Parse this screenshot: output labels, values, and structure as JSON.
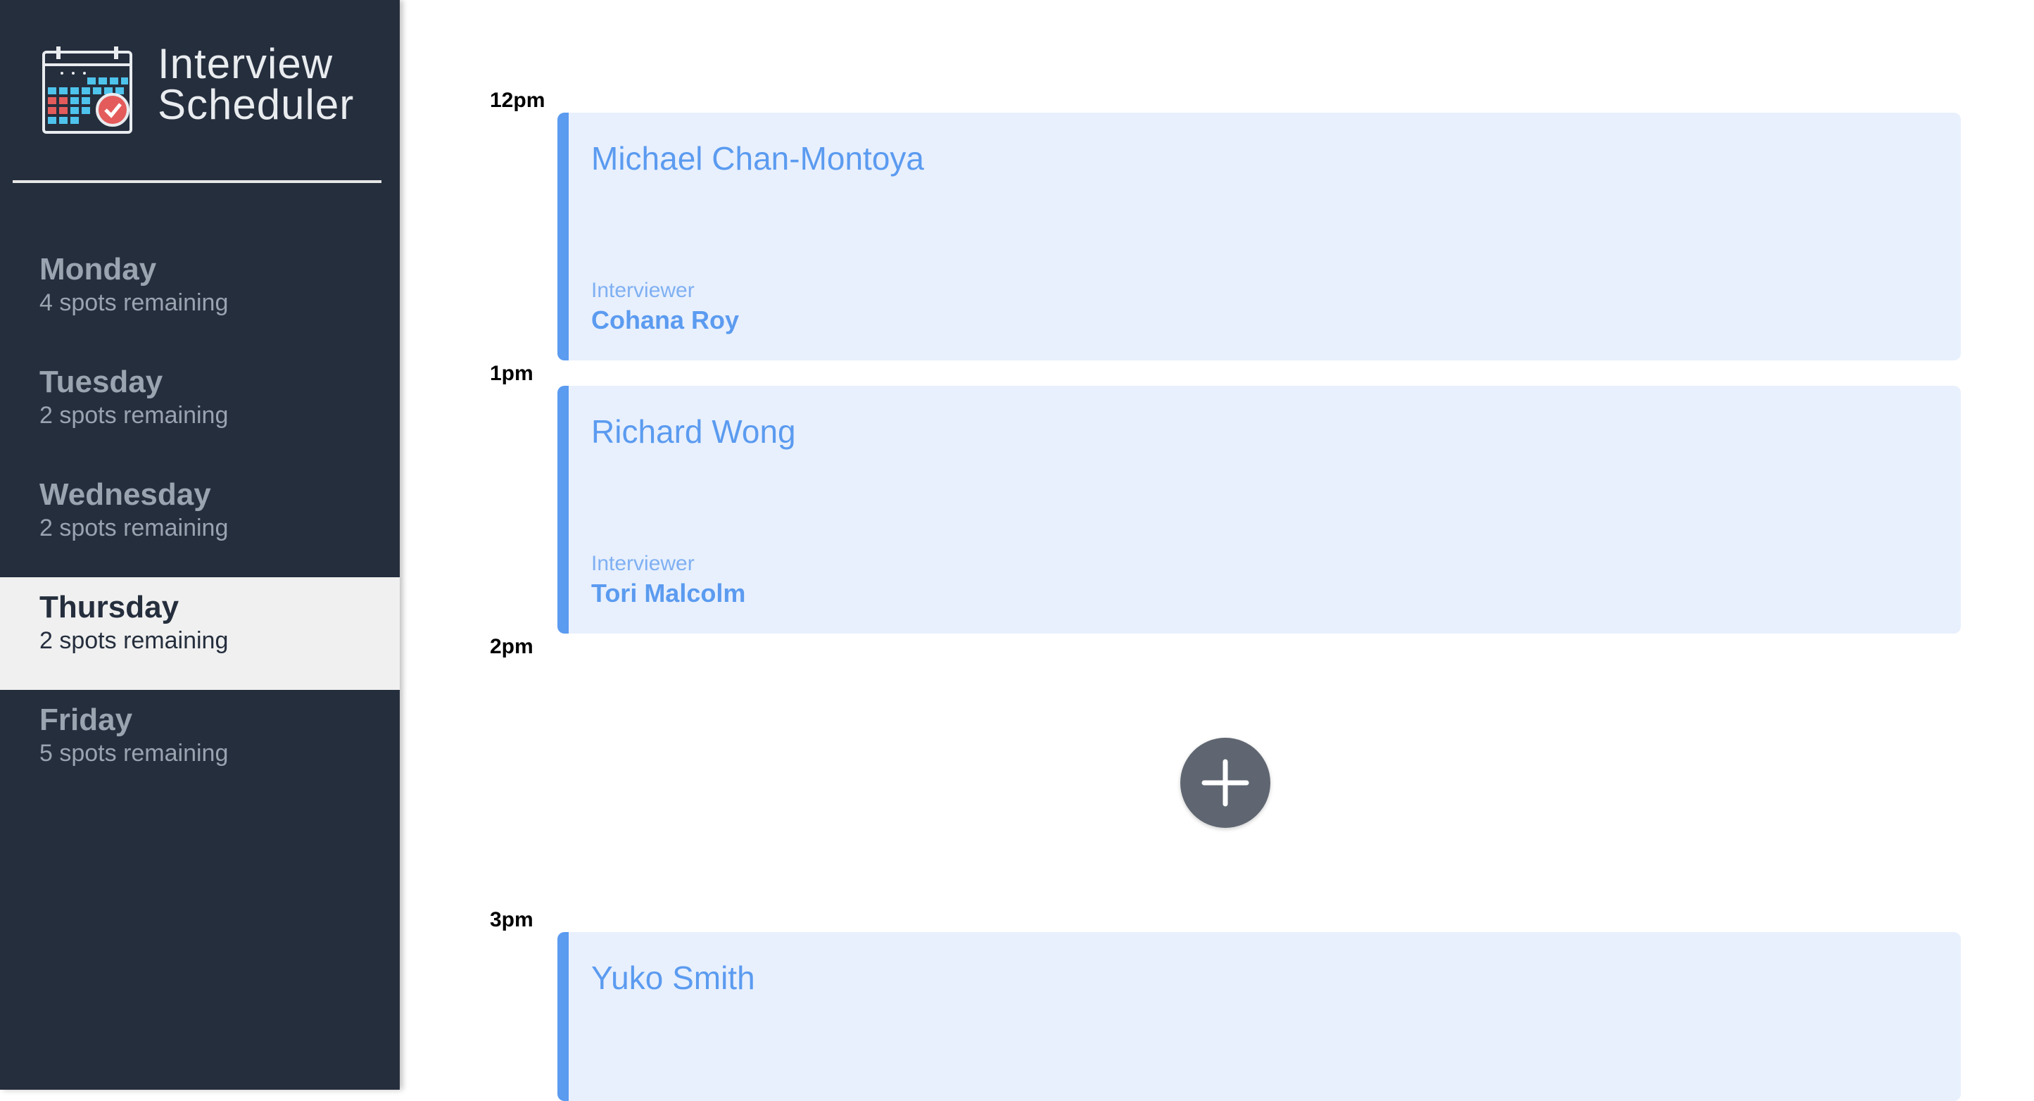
{
  "app": {
    "title_line1": "Interview",
    "title_line2": "Scheduler",
    "logo_icon": "calendar-check-icon"
  },
  "days": [
    {
      "name": "Monday",
      "spots": "4 spots remaining",
      "selected": false
    },
    {
      "name": "Tuesday",
      "spots": "2 spots remaining",
      "selected": false
    },
    {
      "name": "Wednesday",
      "spots": "2 spots remaining",
      "selected": false
    },
    {
      "name": "Thursday",
      "spots": "2 spots remaining",
      "selected": true
    },
    {
      "name": "Friday",
      "spots": "5 spots remaining",
      "selected": false
    }
  ],
  "schedule": {
    "times": [
      "12pm",
      "1pm",
      "2pm",
      "3pm"
    ],
    "appointments": [
      {
        "time": "12pm",
        "student": "Michael Chan-Montoya",
        "interviewer_label": "Interviewer",
        "interviewer": "Cohana Roy"
      },
      {
        "time": "1pm",
        "student": "Richard Wong",
        "interviewer_label": "Interviewer",
        "interviewer": "Tori Malcolm"
      },
      {
        "time": "3pm",
        "student": "Yuko Smith",
        "interviewer_label": "",
        "interviewer": ""
      }
    ],
    "add_icon": "plus-icon"
  },
  "colors": {
    "sidebar_bg": "#252e3d",
    "accent": "#5b9bf0",
    "appointment_bg": "#e8f0fd",
    "add_button_bg": "#5f6671"
  }
}
